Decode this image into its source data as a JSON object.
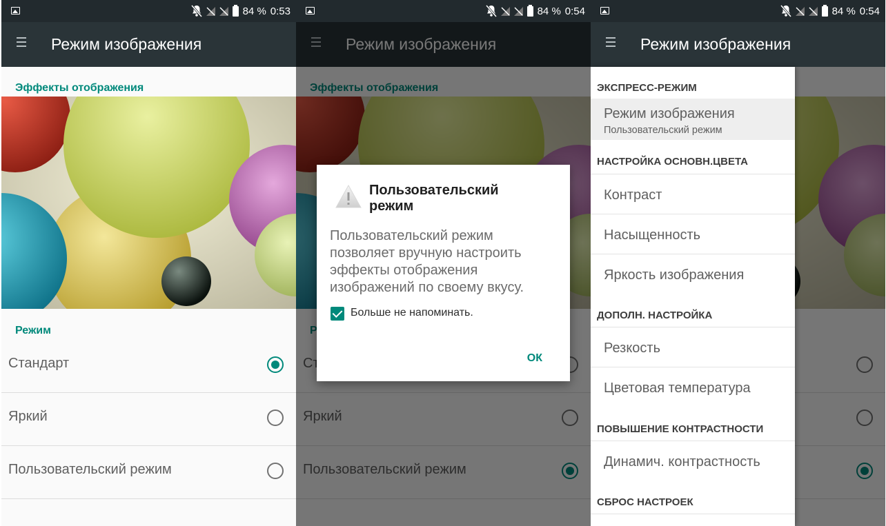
{
  "status_bars": [
    {
      "battery": "84 %",
      "time": "0:53"
    },
    {
      "battery": "84 %",
      "time": "0:54"
    },
    {
      "battery": "84 %",
      "time": "0:54"
    }
  ],
  "toolbar": {
    "title": "Режим изображения",
    "menu_icon": "hamburger-menu-icon"
  },
  "effects_section": {
    "title": "Эффекты отображения"
  },
  "mode_section": {
    "title": "Режим",
    "title_partial": "Р",
    "options": [
      {
        "label": "Стандарт",
        "label_partial": "Ст"
      },
      {
        "label": "Яркий"
      },
      {
        "label": "Пользовательский режим"
      }
    ]
  },
  "dialog": {
    "title": "Пользовательский режим",
    "body": "Пользовательский режим позволяет вручную настроить эффекты отображения изображений по своему вкусу.",
    "checkbox_label": "Больше не напоминать.",
    "checkbox_checked": true,
    "ok_label": "ОК"
  },
  "menu": {
    "express_head": "ЭКСПРЕСС-РЕЖИМ",
    "image_mode": {
      "label": "Режим изображения",
      "sub": "Пользовательский режим"
    },
    "basic_color_head": "НАСТРОЙКА ОСНОВН.ЦВЕТА",
    "contrast": "Контраст",
    "saturation": "Насыщенность",
    "brightness": "Яркость изображения",
    "extra_head": "ДОПОЛН. НАСТРОЙКА",
    "sharpness": "Резкость",
    "color_temp": "Цветовая температура",
    "contrast_boost_head": "ПОВЫШЕНИЕ КОНТРАСТНОСТИ",
    "dynamic_contrast": "Динамич. контрастность",
    "reset_head": "СБРОС НАСТРОЕК"
  },
  "colors": {
    "accent": "#00897b",
    "toolbar": "#2a3438",
    "statusbar": "#222a2e"
  }
}
